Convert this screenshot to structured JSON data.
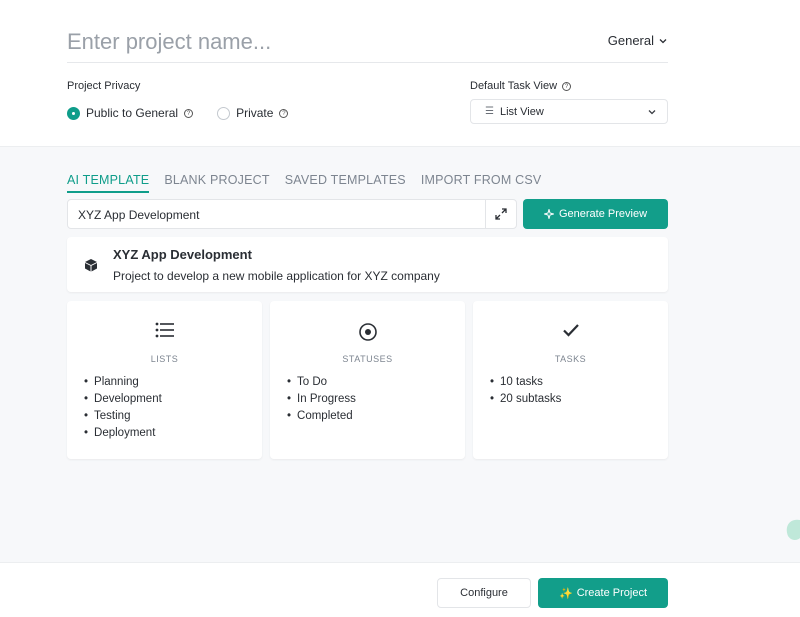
{
  "header": {
    "name_placeholder": "Enter project name...",
    "space_label": "General"
  },
  "privacy": {
    "label": "Project Privacy",
    "options": [
      {
        "label": "Public to General",
        "selected": true
      },
      {
        "label": "Private",
        "selected": false
      }
    ]
  },
  "task_view": {
    "label": "Default Task View",
    "value": "List View"
  },
  "tabs": [
    {
      "label": "AI TEMPLATE",
      "active": true
    },
    {
      "label": "BLANK PROJECT",
      "active": false
    },
    {
      "label": "SAVED TEMPLATES",
      "active": false
    },
    {
      "label": "IMPORT FROM CSV",
      "active": false
    }
  ],
  "prompt": {
    "value": "XYZ App Development",
    "generate_label": "Generate Preview"
  },
  "preview": {
    "title": "XYZ App Development",
    "description": "Project to develop a new mobile application for XYZ company"
  },
  "cards": {
    "lists": {
      "title": "LISTS",
      "items": [
        "Planning",
        "Development",
        "Testing",
        "Deployment"
      ]
    },
    "statuses": {
      "title": "STATUSES",
      "items": [
        "To Do",
        "In Progress",
        "Completed"
      ]
    },
    "tasks": {
      "title": "TASKS",
      "items": [
        "10 tasks",
        "20 subtasks"
      ]
    }
  },
  "footer": {
    "configure_label": "Configure",
    "create_label": "Create Project"
  },
  "colors": {
    "accent": "#129e8a",
    "muted_text": "#7d8590",
    "panel_bg": "#f7f8fa"
  }
}
